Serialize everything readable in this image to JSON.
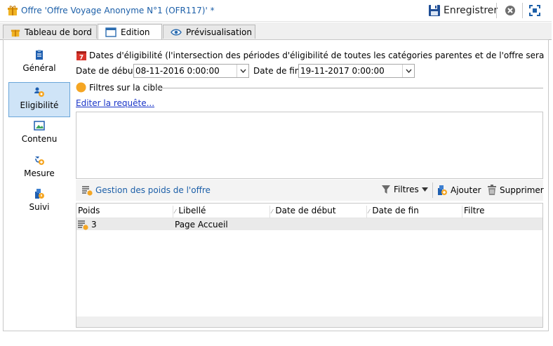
{
  "window": {
    "title": "Offre 'Offre Voyage Anonyme N°1 (OFR117)' *",
    "save_label": "Enregistrer"
  },
  "tabs": [
    {
      "label": "Tableau de bord"
    },
    {
      "label": "Edition"
    },
    {
      "label": "Prévisualisation"
    }
  ],
  "sidebar": {
    "items": [
      {
        "label": "Général"
      },
      {
        "label": "Eligibilité"
      },
      {
        "label": "Contenu"
      },
      {
        "label": "Mesure"
      },
      {
        "label": "Suivi"
      }
    ]
  },
  "eligibility": {
    "section_title": "Dates d'éligibilité (l'intersection des périodes d'éligibilité de toutes les catégories parentes et de l'offre sera prise en compte)",
    "start_label": "Date de début:",
    "start_value": "08-11-2016 0:00:00",
    "end_label": "Date de fin:",
    "end_value": "19-11-2017 0:00:00",
    "filters_label": "Filtres sur la cible",
    "edit_query": "Editer la requête..."
  },
  "weights": {
    "title": "Gestion des poids de l'offre",
    "filters_btn": "Filtres",
    "add_btn": "Ajouter",
    "delete_btn": "Supprimer",
    "columns": [
      "Poids",
      "Libellé",
      "Date de début",
      "Date de fin",
      "Filtre"
    ],
    "rows": [
      {
        "poids": "3",
        "libelle": "Page Accueil",
        "date_debut": "",
        "date_fin": "",
        "filtre": ""
      }
    ]
  },
  "colors": {
    "accent": "#1c5fa8",
    "selected_bg": "#cfe4f7",
    "orange": "#f5a623",
    "red": "#d9342b"
  }
}
